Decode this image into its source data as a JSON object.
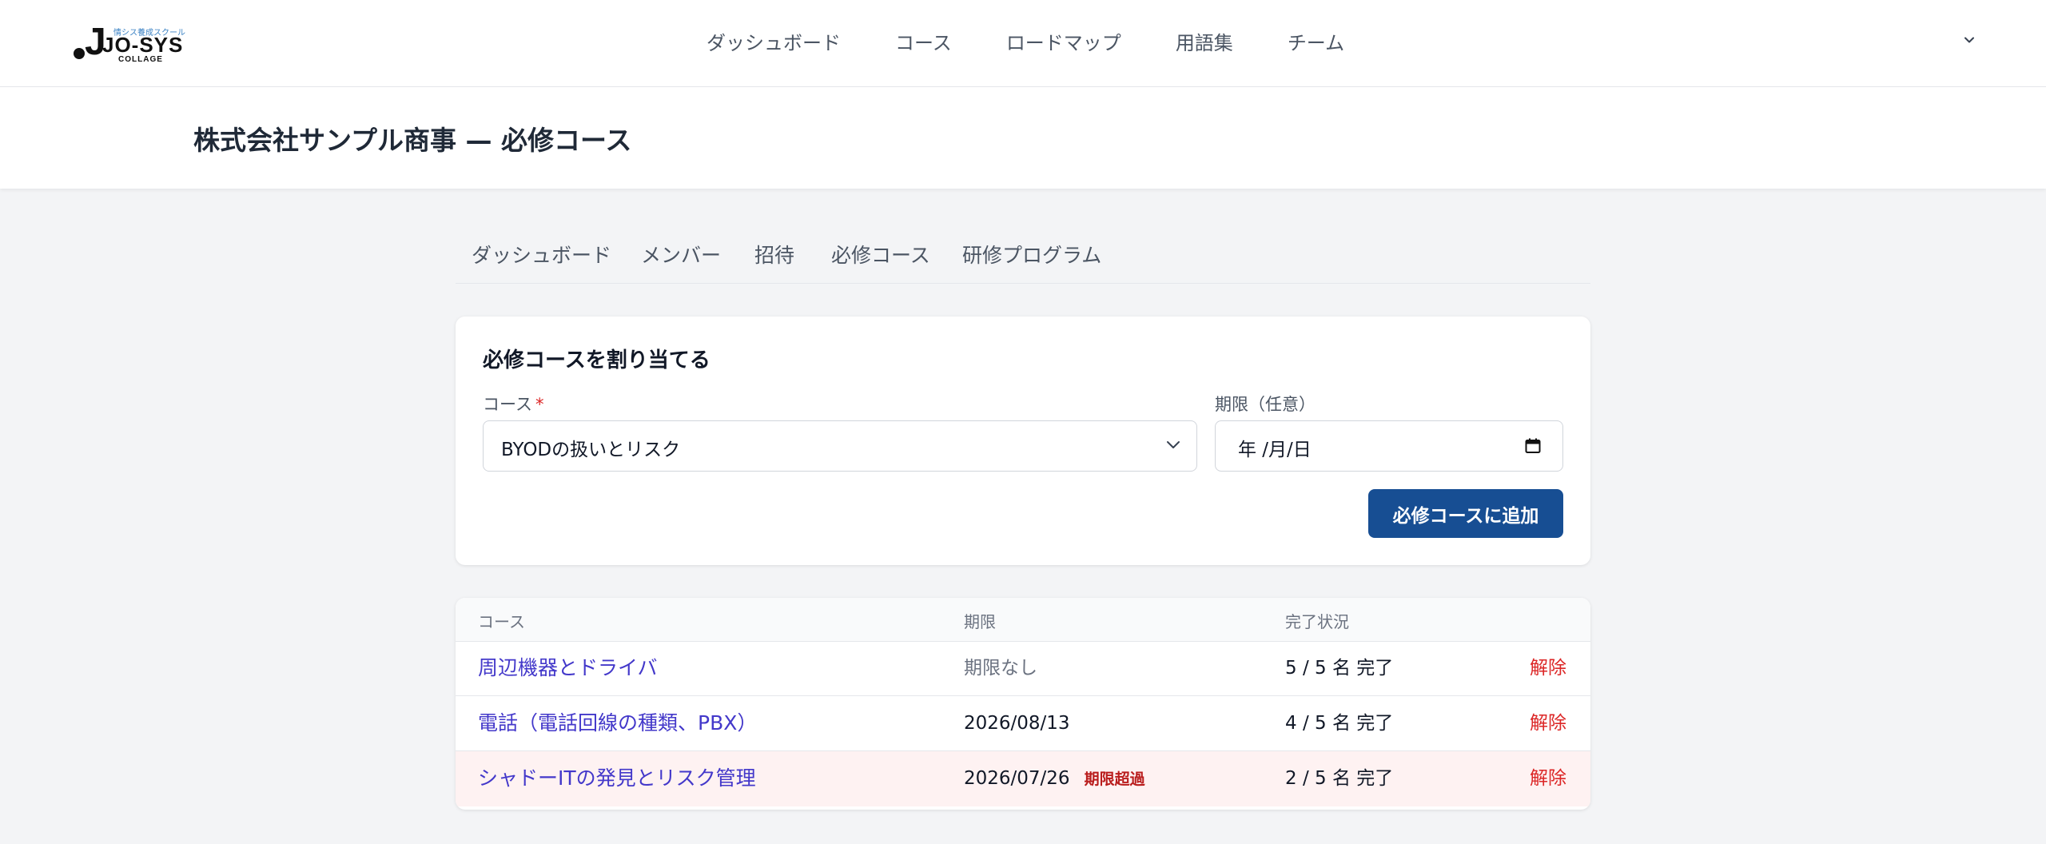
{
  "brand": {
    "logo_tagline": "情シス養成スクール",
    "logo_main": "JO-SYS",
    "logo_sub": "COLLAGE"
  },
  "topnav": {
    "items": [
      "ダッシュボード",
      "コース",
      "ロードマップ",
      "用語集",
      "チーム"
    ]
  },
  "page": {
    "title": "株式会社サンプル商事 — 必修コース"
  },
  "subtabs": [
    "ダッシュボード",
    "メンバー",
    "招待",
    "必修コース",
    "研修プログラム"
  ],
  "assign_form": {
    "title": "必修コースを割り当てる",
    "course_label": "コース",
    "required_mark": "*",
    "course_value": "BYODの扱いとリスク",
    "deadline_label": "期限（任意）",
    "deadline_value": "年 /月/日",
    "submit_label": "必修コースに追加"
  },
  "table": {
    "headers": [
      "コース",
      "期限",
      "完了状況"
    ],
    "rows": [
      {
        "course": "周辺機器とドライバ",
        "deadline": "期限なし",
        "progress": "5 / 5 名 完了",
        "action": "解除",
        "overdue_label": ""
      },
      {
        "course": "電話（電話回線の種類、PBX）",
        "deadline": "2026/08/13",
        "progress": "4 / 5 名 完了",
        "action": "解除",
        "overdue_label": ""
      },
      {
        "course": "シャドーITの発見とリスク管理",
        "deadline": "2026/07/26",
        "progress": "2 / 5 名 完了",
        "action": "解除",
        "overdue_label": "期限超過"
      }
    ]
  },
  "colors": {
    "primary_button": "#174e93",
    "link": "#4338ca",
    "danger": "#dc2626",
    "overdue_row_bg": "#fef2f2"
  }
}
